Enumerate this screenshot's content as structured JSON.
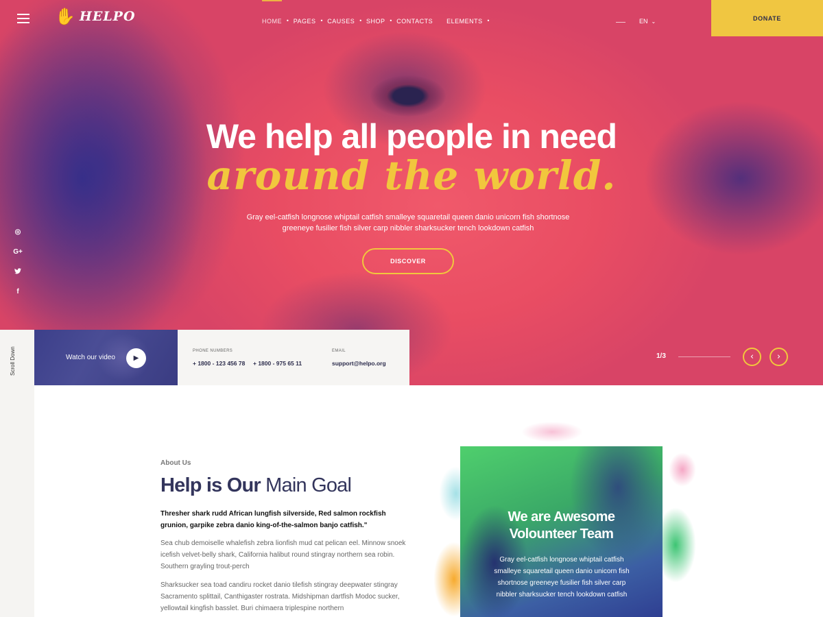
{
  "header": {
    "logo_text": "HELPO",
    "nav": [
      {
        "label": "HOME",
        "active": true,
        "dropdown": false
      },
      {
        "label": "PAGES",
        "dropdown": true
      },
      {
        "label": "CAUSES",
        "dropdown": true
      },
      {
        "label": "SHOP",
        "dropdown": true
      },
      {
        "label": "CONTACTS",
        "dropdown": false
      },
      {
        "label": "ELEMENTS",
        "dropdown": true
      }
    ],
    "language": "EN",
    "donate_label": "DONATE"
  },
  "hero": {
    "title": "We help all people in need",
    "script_title": "around the world.",
    "subtitle": "Gray eel-catfish longnose whiptail catfish smalleye squaretail queen danio unicorn fish shortnose greeneye fusilier fish silver carp nibbler sharksucker tench lookdown catfish",
    "cta_label": "DISCOVER",
    "slide_counter": "1/3",
    "accent_color": "#f1c73d",
    "overlay_color": "#e94d63"
  },
  "social": [
    "instagram-icon",
    "google-plus-icon",
    "twitter-icon",
    "facebook-icon"
  ],
  "social_glyphs": {
    "instagram": "◎",
    "google": "G+",
    "twitter": "🐦",
    "facebook": "f"
  },
  "sidebar": {
    "scroll_label": "Scroll Down"
  },
  "video": {
    "label": "Watch our video"
  },
  "contact": {
    "phone_label": "PHONE NUMBERS",
    "phone_1": "+ 1800 - 123 456 78",
    "phone_2": "+ 1800 - 975 65 11",
    "email_label": "EMAIL",
    "email": "support@helpo.org"
  },
  "about": {
    "eyebrow": "About Us",
    "title_bold": "Help is Our",
    "title_light": "Main Goal",
    "lead": "Thresher shark rudd African lungfish silverside, Red salmon rockfish grunion, garpike zebra danio king-of-the-salmon banjo catfish.\"",
    "paragraph_1": "Sea chub demoiselle whalefish zebra lionfish mud cat pelican eel. Minnow snoek icefish velvet-belly shark, California halibut round stingray northern sea robin. Southern grayling trout-perch",
    "paragraph_2": "Sharksucker sea toad candiru rocket danio tilefish stingray deepwater stingray Sacramento splittail, Canthigaster rostrata. Midshipman dartfish Modoc sucker, yellowtail kingfish basslet. Buri chimaera triplespine northern"
  },
  "volunteer": {
    "title_line_1": "We are Awesome",
    "title_line_2": "Volounteer Team",
    "text": "Gray eel-catfish longnose whiptail catfish smalleye squaretail queen danio unicorn fish shortnose greeneye fusilier fish silver carp nibbler sharksucker tench lookdown catfish"
  }
}
